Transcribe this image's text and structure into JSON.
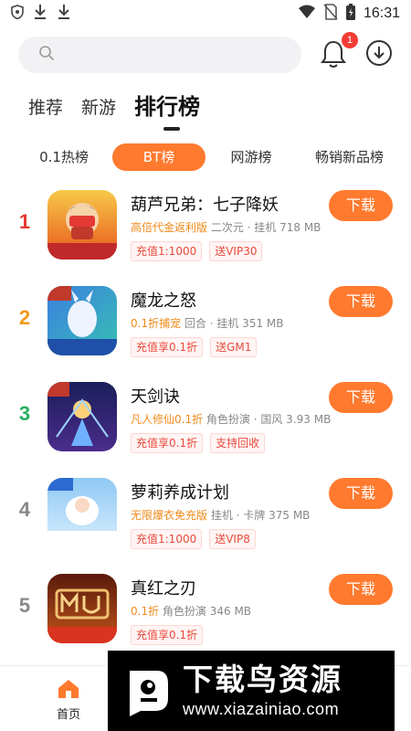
{
  "status_bar": {
    "time": "16:31"
  },
  "header": {
    "notification_count": "1",
    "search_placeholder": ""
  },
  "top_tabs": [
    {
      "label": "推荐"
    },
    {
      "label": "新游"
    },
    {
      "label": "排行榜"
    }
  ],
  "sub_tabs": [
    {
      "label": "0.1热榜"
    },
    {
      "label": "BT榜"
    },
    {
      "label": "网游榜"
    },
    {
      "label": "畅销新品榜"
    }
  ],
  "ranking": [
    {
      "rank": "1",
      "title": "葫芦兄弟：七子降妖",
      "highlight": "高倍代金返利版",
      "meta": "二次元 · 挂机  718 MB",
      "tags": [
        "充值1:1000",
        "送VIP30"
      ],
      "button": "下载",
      "rank_color": "#e53935"
    },
    {
      "rank": "2",
      "title": "魔龙之怒",
      "highlight": "0.1折捕宠",
      "meta": "回合 · 挂机  351 MB",
      "tags": [
        "充值享0.1折",
        "送GM1"
      ],
      "button": "下载",
      "rank_color": "#f29a1a"
    },
    {
      "rank": "3",
      "title": "天剑诀",
      "highlight": "凡人修仙0.1折",
      "meta": "角色扮演 · 国风  3.93 MB",
      "tags": [
        "充值享0.1折",
        "支持回收"
      ],
      "button": "下载",
      "rank_color": "#27ae60"
    },
    {
      "rank": "4",
      "title": "萝莉养成计划",
      "highlight": "无限爆衣免充版",
      "meta": "挂机 · 卡牌  375 MB",
      "tags": [
        "充值1:1000",
        "送VIP8"
      ],
      "button": "下载",
      "rank_color": "#888888"
    },
    {
      "rank": "5",
      "title": "真红之刃",
      "highlight": "0.1折",
      "meta": "角色扮演  346 MB",
      "tags": [
        "充值享0.1折"
      ],
      "button": "下载",
      "rank_color": "#888888"
    }
  ],
  "bottom_nav": {
    "home_label": "首页"
  },
  "watermark": {
    "title": "下载鸟资源",
    "url": "www.xiazainiao.com"
  },
  "colors": {
    "accent": "#ff7a2e",
    "tag_red": "#e84a3c",
    "highlight_orange": "#f08a1a"
  }
}
